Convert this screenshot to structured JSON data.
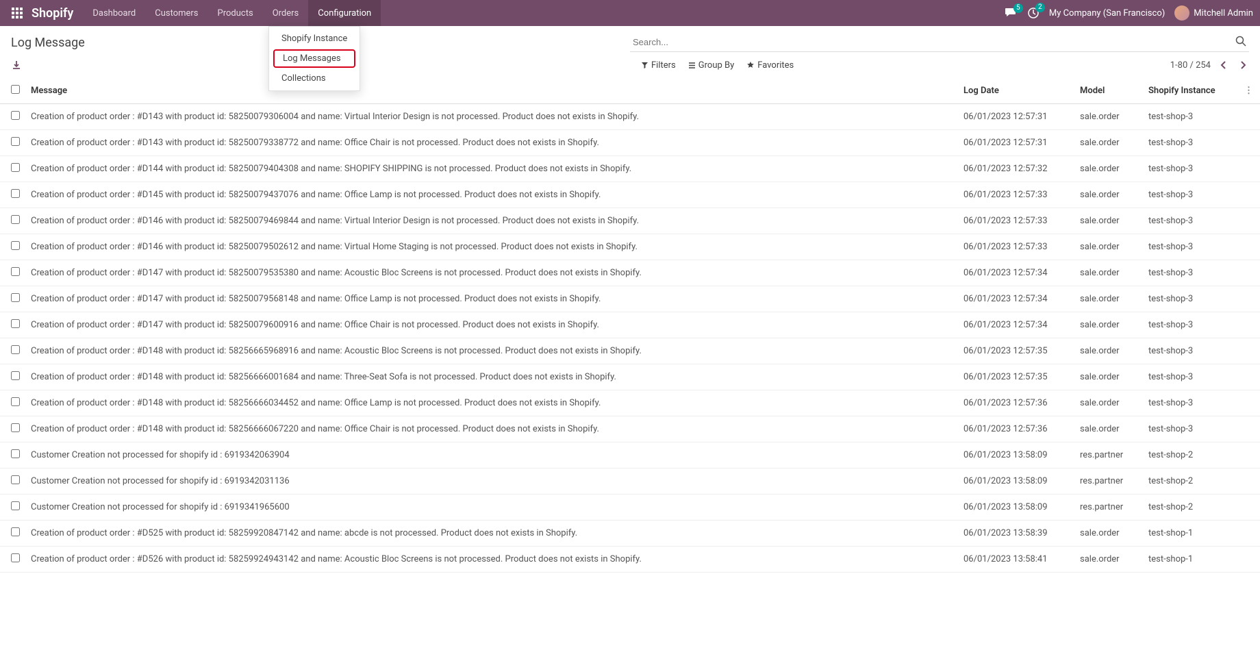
{
  "app": {
    "name": "Shopify"
  },
  "nav": {
    "dashboard": "Dashboard",
    "customers": "Customers",
    "products": "Products",
    "orders": "Orders",
    "configuration": "Configuration"
  },
  "config_menu": {
    "shopify_instance": "Shopify Instance",
    "log_messages": "Log Messages",
    "collections": "Collections"
  },
  "topbar": {
    "chat_badge": "5",
    "activity_badge": "2",
    "company": "My Company (San Francisco)",
    "user": "Mitchell Admin"
  },
  "page": {
    "title": "Log Message"
  },
  "search": {
    "placeholder": "Search..."
  },
  "filters": {
    "filters_label": "Filters",
    "group_by_label": "Group By",
    "favorites_label": "Favorites"
  },
  "pager": {
    "range": "1-80 / 254"
  },
  "columns": {
    "message": "Message",
    "log_date": "Log Date",
    "model": "Model",
    "shopify_instance": "Shopify Instance"
  },
  "rows": [
    {
      "message": "Creation of product order : #D143 with product id: 58250079306004 and name: Virtual Interior Design is not processed. Product does not exists in Shopify.",
      "log_date": "06/01/2023 12:57:31",
      "model": "sale.order",
      "instance": "test-shop-3"
    },
    {
      "message": "Creation of product order : #D143 with product id: 58250079338772 and name: Office Chair is not processed. Product does not exists in Shopify.",
      "log_date": "06/01/2023 12:57:31",
      "model": "sale.order",
      "instance": "test-shop-3"
    },
    {
      "message": "Creation of product order : #D144 with product id: 58250079404308 and name: SHOPIFY SHIPPING is not processed. Product does not exists in Shopify.",
      "log_date": "06/01/2023 12:57:32",
      "model": "sale.order",
      "instance": "test-shop-3"
    },
    {
      "message": "Creation of product order : #D145 with product id: 58250079437076 and name: Office Lamp is not processed. Product does not exists in Shopify.",
      "log_date": "06/01/2023 12:57:33",
      "model": "sale.order",
      "instance": "test-shop-3"
    },
    {
      "message": "Creation of product order : #D146 with product id: 58250079469844 and name: Virtual Interior Design is not processed. Product does not exists in Shopify.",
      "log_date": "06/01/2023 12:57:33",
      "model": "sale.order",
      "instance": "test-shop-3"
    },
    {
      "message": "Creation of product order : #D146 with product id: 58250079502612 and name: Virtual Home Staging is not processed. Product does not exists in Shopify.",
      "log_date": "06/01/2023 12:57:33",
      "model": "sale.order",
      "instance": "test-shop-3"
    },
    {
      "message": "Creation of product order : #D147 with product id: 58250079535380 and name: Acoustic Bloc Screens is not processed. Product does not exists in Shopify.",
      "log_date": "06/01/2023 12:57:34",
      "model": "sale.order",
      "instance": "test-shop-3"
    },
    {
      "message": "Creation of product order : #D147 with product id: 58250079568148 and name: Office Lamp is not processed. Product does not exists in Shopify.",
      "log_date": "06/01/2023 12:57:34",
      "model": "sale.order",
      "instance": "test-shop-3"
    },
    {
      "message": "Creation of product order : #D147 with product id: 58250079600916 and name: Office Chair is not processed. Product does not exists in Shopify.",
      "log_date": "06/01/2023 12:57:34",
      "model": "sale.order",
      "instance": "test-shop-3"
    },
    {
      "message": "Creation of product order : #D148 with product id: 58256665968916 and name: Acoustic Bloc Screens is not processed. Product does not exists in Shopify.",
      "log_date": "06/01/2023 12:57:35",
      "model": "sale.order",
      "instance": "test-shop-3"
    },
    {
      "message": "Creation of product order : #D148 with product id: 58256666001684 and name: Three-Seat Sofa is not processed. Product does not exists in Shopify.",
      "log_date": "06/01/2023 12:57:35",
      "model": "sale.order",
      "instance": "test-shop-3"
    },
    {
      "message": "Creation of product order : #D148 with product id: 58256666034452 and name: Office Lamp is not processed. Product does not exists in Shopify.",
      "log_date": "06/01/2023 12:57:36",
      "model": "sale.order",
      "instance": "test-shop-3"
    },
    {
      "message": "Creation of product order : #D148 with product id: 58256666067220 and name: Office Chair is not processed. Product does not exists in Shopify.",
      "log_date": "06/01/2023 12:57:36",
      "model": "sale.order",
      "instance": "test-shop-3"
    },
    {
      "message": "Customer Creation not processed for shopify id : 6919342063904",
      "log_date": "06/01/2023 13:58:09",
      "model": "res.partner",
      "instance": "test-shop-2"
    },
    {
      "message": "Customer Creation not processed for shopify id : 6919342031136",
      "log_date": "06/01/2023 13:58:09",
      "model": "res.partner",
      "instance": "test-shop-2"
    },
    {
      "message": "Customer Creation not processed for shopify id : 6919341965600",
      "log_date": "06/01/2023 13:58:09",
      "model": "res.partner",
      "instance": "test-shop-2"
    },
    {
      "message": "Creation of product order : #D525 with product id: 58259920847142 and name: abcde is not processed. Product does not exists in Shopify.",
      "log_date": "06/01/2023 13:58:39",
      "model": "sale.order",
      "instance": "test-shop-1"
    },
    {
      "message": "Creation of product order : #D526 with product id: 58259924943142 and name: Acoustic Bloc Screens is not processed. Product does not exists in Shopify.",
      "log_date": "06/01/2023 13:58:41",
      "model": "sale.order",
      "instance": "test-shop-1"
    }
  ]
}
